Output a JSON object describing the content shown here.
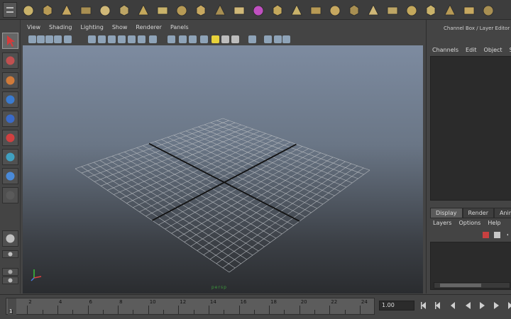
{
  "panel_menu": [
    "View",
    "Shading",
    "Lighting",
    "Show",
    "Renderer",
    "Panels"
  ],
  "channel_box": {
    "title": "Channel Box / Layer Editor",
    "menu": [
      "Channels",
      "Edit",
      "Object",
      "Sh"
    ]
  },
  "layer_editor": {
    "tabs": [
      "Display",
      "Render",
      "Anim"
    ],
    "active_tab": "Display",
    "menu": [
      "Layers",
      "Options",
      "Help"
    ]
  },
  "timeline": {
    "tick_labels": [
      "2",
      "4",
      "6",
      "8",
      "10",
      "12",
      "14",
      "16",
      "18",
      "20",
      "22",
      "24"
    ],
    "current_frame": "1",
    "start_time": "1.00"
  },
  "viewport": {
    "camera_label": "persp"
  },
  "icons": {
    "shelf": [
      "sphere-icon",
      "cube-icon",
      "cylinder-icon",
      "cone-icon",
      "plane-icon",
      "torus-icon",
      "prism-icon",
      "pipe-icon",
      "helix-icon",
      "soccer-ball-icon",
      "platonic-icon",
      "subdiv-icon",
      "selected-cube-icon",
      "extrude-icon",
      "bevel-icon",
      "bridge-icon",
      "append-icon",
      "split-icon",
      "insert-loop-icon",
      "smooth-icon",
      "combine-icon",
      "separate-icon",
      "mirror-icon",
      "checker-icon",
      "uv-icon"
    ],
    "tools": [
      "select-tool-icon",
      "lasso-tool-icon",
      "paint-select-icon",
      "move-tool-icon",
      "rotate-tool-icon",
      "scale-tool-icon",
      "manipulator-icon",
      "soft-mod-icon",
      "last-tool-icon",
      "layout-single-icon",
      "layout-four-icon",
      "outliner-icon",
      "render-view-icon"
    ]
  },
  "colors": {
    "viewport_top": "#7d8ba0",
    "viewport_bottom": "#2a2c2f",
    "grid": "#b4b8bd",
    "axis": "#111111"
  }
}
